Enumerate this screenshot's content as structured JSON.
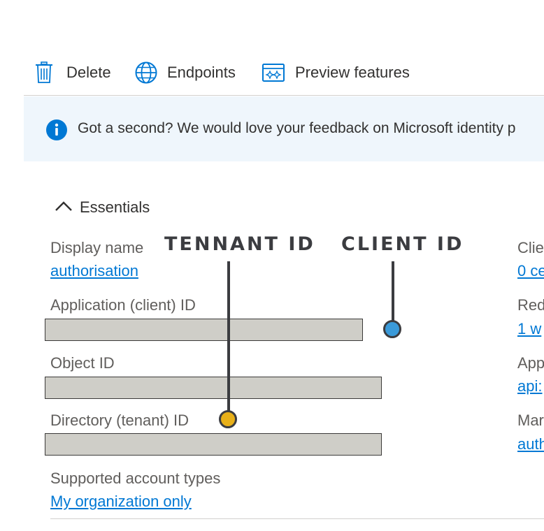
{
  "toolbar": {
    "delete_label": "Delete",
    "endpoints_label": "Endpoints",
    "preview_label": "Preview features"
  },
  "banner": {
    "text": "Got a second? We would love your feedback on Microsoft identity p"
  },
  "essentials": {
    "title": "Essentials",
    "display_name_label": "Display name",
    "display_name_value": "authorisation",
    "app_id_label": "Application (client) ID",
    "object_id_label": "Object ID",
    "directory_id_label": "Directory (tenant) ID",
    "account_types_label": "Supported account types",
    "account_types_value": "My organization only"
  },
  "right_column": {
    "items": [
      {
        "label": "Clie",
        "value": "0 ce"
      },
      {
        "label": "Red",
        "value": "1 w"
      },
      {
        "label": "App",
        "value": "api:"
      },
      {
        "label": "Mar",
        "value": "auth"
      }
    ]
  },
  "annotations": {
    "tenant_label": "TENNANT ID",
    "client_label": "CLIENT ID"
  },
  "colors": {
    "accent": "#0078d4",
    "banner_bg": "#eff6fc",
    "tenant_dot": "#e8b019",
    "client_dot": "#3a9ad9",
    "redaction": "#cfcec8"
  }
}
